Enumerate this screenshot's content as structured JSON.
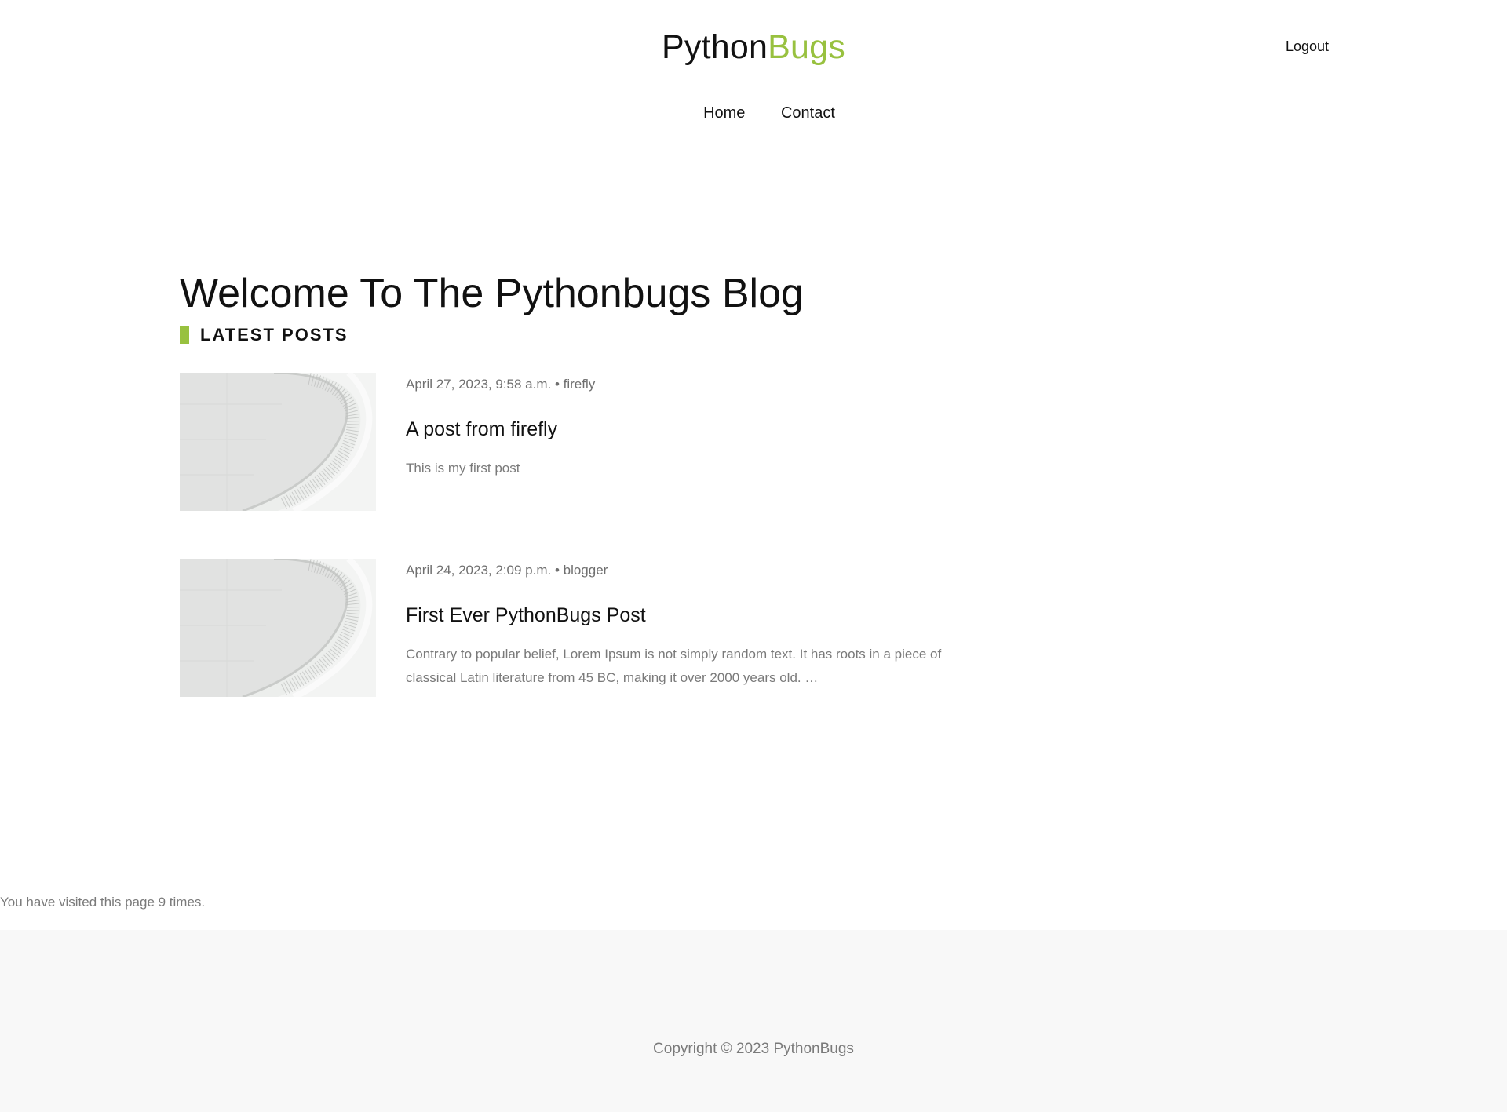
{
  "header": {
    "logo_part1": "Python",
    "logo_part2": "Bugs",
    "logout_label": "Logout",
    "nav": [
      {
        "label": "Home"
      },
      {
        "label": "Contact"
      }
    ]
  },
  "main": {
    "title": "Welcome To The Pythonbugs Blog",
    "section_label": "LATEST POSTS",
    "posts": [
      {
        "meta": "April 27, 2023, 9:58 a.m. • firefly",
        "title": "A post from firefly",
        "excerpt": "This is my first post"
      },
      {
        "meta": "April 24, 2023, 2:09 p.m. • blogger",
        "title": "First Ever PythonBugs Post",
        "excerpt": "Contrary to popular belief, Lorem Ipsum is not simply random text. It has roots in a piece of classical Latin literature from 45 BC, making it over 2000 years old. …"
      }
    ]
  },
  "visits_text": "You have visited this page 9 times.",
  "footer": {
    "copyright": "Copyright © 2023 PythonBugs"
  },
  "colors": {
    "accent": "#98c13f",
    "text": "#111111",
    "muted": "#7a7a7a",
    "footer_bg": "#f8f8f8"
  }
}
